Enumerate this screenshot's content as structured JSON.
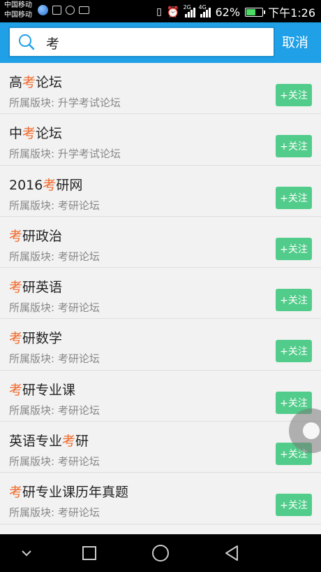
{
  "status": {
    "carrier1": "中国移动",
    "carrier2": "中国移动",
    "net1": "2G",
    "net2": "4G",
    "battery": "62%",
    "battery_level": 0.62,
    "time": "下午1:26"
  },
  "search": {
    "value": "考",
    "cancel_label": "取消"
  },
  "results": [
    {
      "pre": "高",
      "hl": "考",
      "post": "论坛",
      "forum": "所属版块: 升学考试论坛",
      "action": "+关注"
    },
    {
      "pre": "中",
      "hl": "考",
      "post": "论坛",
      "forum": "所属版块: 升学考试论坛",
      "action": "+关注"
    },
    {
      "pre": "2016",
      "hl": "考",
      "post": "研网",
      "forum": "所属版块: 考研论坛",
      "action": "+关注"
    },
    {
      "pre": "",
      "hl": "考",
      "post": "研政治",
      "forum": "所属版块: 考研论坛",
      "action": "+关注"
    },
    {
      "pre": "",
      "hl": "考",
      "post": "研英语",
      "forum": "所属版块: 考研论坛",
      "action": "+关注"
    },
    {
      "pre": "",
      "hl": "考",
      "post": "研数学",
      "forum": "所属版块: 考研论坛",
      "action": "+关注"
    },
    {
      "pre": "",
      "hl": "考",
      "post": "研专业课",
      "forum": "所属版块: 考研论坛",
      "action": "+关注"
    },
    {
      "pre": "英语专业",
      "hl": "考",
      "post": "研",
      "forum": "所属版块: 考研论坛",
      "action": "+关注"
    },
    {
      "pre": "",
      "hl": "考",
      "post": "研专业课历年真题",
      "forum": "所属版块: 考研论坛",
      "action": "+关注"
    }
  ],
  "colors": {
    "header": "#1fa0e7",
    "highlight": "#f0692a",
    "follow": "#52cc8a"
  },
  "navbar": {
    "icons": [
      "chevron-down-icon",
      "square-recent-icon",
      "circle-home-icon",
      "triangle-back-icon"
    ]
  }
}
